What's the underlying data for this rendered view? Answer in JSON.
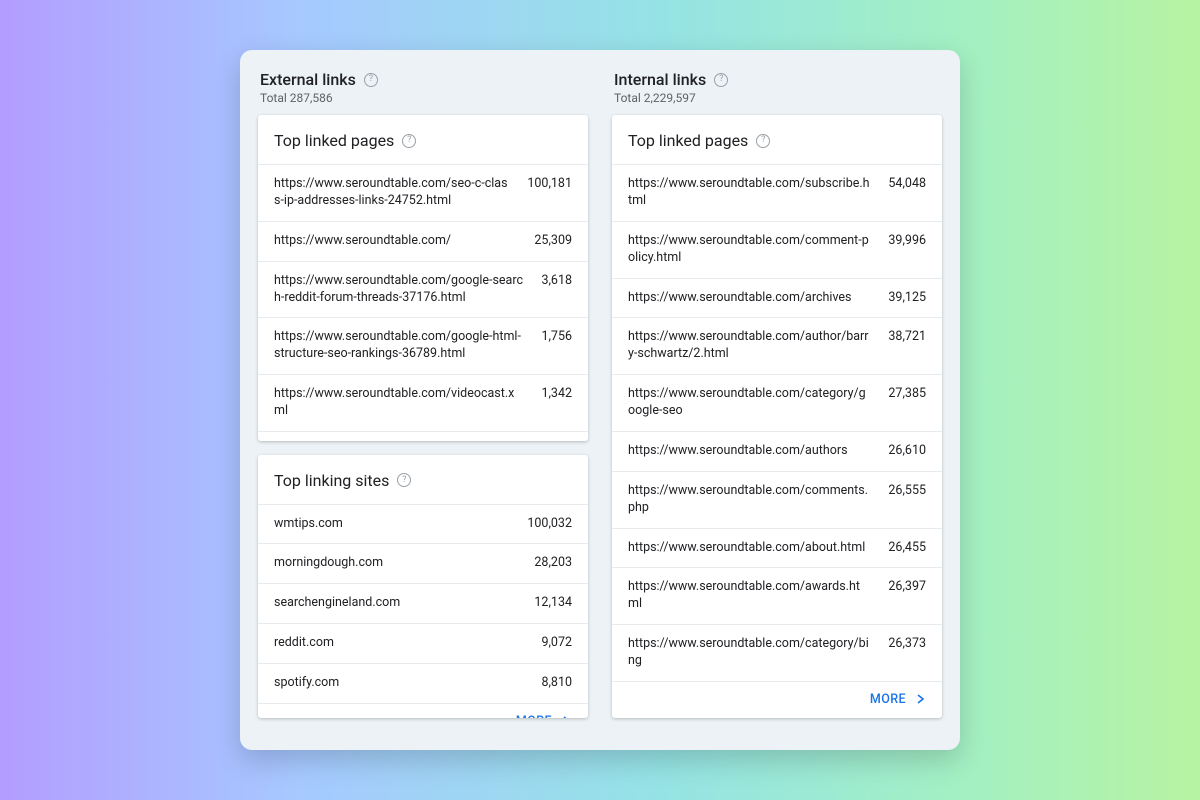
{
  "more_label": "MORE",
  "external": {
    "title": "External links",
    "total_label": "Total 287,586",
    "top_linked_pages_title": "Top linked pages",
    "top_linked_pages": [
      {
        "url": "https://www.seroundtable.com/seo-c-class-ip-addresses-links-24752.html",
        "count": "100,181"
      },
      {
        "url": "https://www.seroundtable.com/",
        "count": "25,309"
      },
      {
        "url": "https://www.seroundtable.com/google-search-reddit-forum-threads-37176.html",
        "count": "3,618"
      },
      {
        "url": "https://www.seroundtable.com/google-html-structure-seo-rankings-36789.html",
        "count": "1,756"
      },
      {
        "url": "https://www.seroundtable.com/videocast.xml",
        "count": "1,342"
      }
    ],
    "top_linking_sites_title": "Top linking sites",
    "top_linking_sites": [
      {
        "site": "wmtips.com",
        "count": "100,032"
      },
      {
        "site": "morningdough.com",
        "count": "28,203"
      },
      {
        "site": "searchengineland.com",
        "count": "12,134"
      },
      {
        "site": "reddit.com",
        "count": "9,072"
      },
      {
        "site": "spotify.com",
        "count": "8,810"
      }
    ]
  },
  "internal": {
    "title": "Internal links",
    "total_label": "Total 2,229,597",
    "top_linked_pages_title": "Top linked pages",
    "top_linked_pages": [
      {
        "url": "https://www.seroundtable.com/subscribe.html",
        "count": "54,048"
      },
      {
        "url": "https://www.seroundtable.com/comment-policy.html",
        "count": "39,996"
      },
      {
        "url": "https://www.seroundtable.com/archives",
        "count": "39,125"
      },
      {
        "url": "https://www.seroundtable.com/author/barry-schwartz/2.html",
        "count": "38,721"
      },
      {
        "url": "https://www.seroundtable.com/category/google-seo",
        "count": "27,385"
      },
      {
        "url": "https://www.seroundtable.com/authors",
        "count": "26,610"
      },
      {
        "url": "https://www.seroundtable.com/comments.php",
        "count": "26,555"
      },
      {
        "url": "https://www.seroundtable.com/about.html",
        "count": "26,455"
      },
      {
        "url": "https://www.seroundtable.com/awards.html",
        "count": "26,397"
      },
      {
        "url": "https://www.seroundtable.com/category/bing",
        "count": "26,373"
      }
    ]
  }
}
